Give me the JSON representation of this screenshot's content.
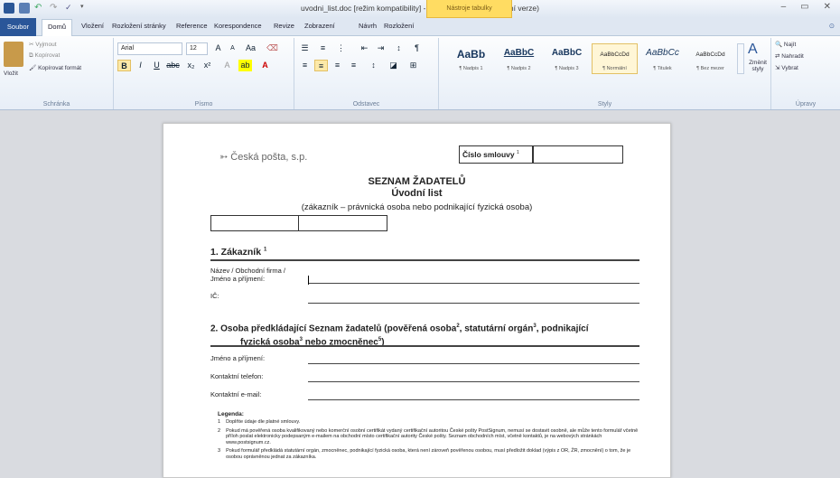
{
  "window": {
    "title": "uvodni_list.doc [režim kompatibility] - Microsoft Word (Zkušební verze)",
    "context_tab": "Nástroje tabulky",
    "controls": [
      "–",
      "▭",
      "✕"
    ]
  },
  "tabs": {
    "file": "Soubor",
    "items": [
      "Domů",
      "Vložení",
      "Rozložení stránky",
      "Reference",
      "Korespondence",
      "Revize",
      "Zobrazení",
      "Návrh",
      "Rozložení"
    ]
  },
  "ribbon": {
    "clipboard": {
      "paste": "Vložit",
      "cut": "Vyjmout",
      "copy": "Kopírovat",
      "format": "Kopírovat formát",
      "label": "Schránka"
    },
    "font": {
      "name": "Arial",
      "size": "12",
      "label": "Písmo"
    },
    "paragraph": {
      "label": "Odstavec"
    },
    "styles": {
      "label": "Styly",
      "change": "Změnit styly",
      "items": [
        {
          "sample": "AaBb",
          "name": "¶ Nadpis 1"
        },
        {
          "sample": "AaBbC",
          "name": "¶ Nadpis 2"
        },
        {
          "sample": "AaBbC",
          "name": "¶ Nadpis 3"
        },
        {
          "sample": "AaBbCcDd",
          "name": "¶ Normální"
        },
        {
          "sample": "AaBbCc",
          "name": "¶ Titulek"
        },
        {
          "sample": "AaBbCcDd",
          "name": "¶ Bez mezer"
        }
      ]
    },
    "editing": {
      "label": "Úpravy",
      "find": "Najít",
      "replace": "Nahradit",
      "select": "Vybrat"
    }
  },
  "document": {
    "logo_text": "Česká pošta, s.p.",
    "contract_label": "Číslo smlouvy",
    "contract_sup": "1",
    "heading1": "SEZNAM ŽADATELŮ",
    "heading2": "Úvodní list",
    "subheading": "(zákazník – právnická osoba nebo podnikající fyzická osoba)",
    "section1": "1. Zákazník",
    "section1_sup": "1",
    "field_name_l1": "Název / Obchodní firma /",
    "field_name_l2": "Jméno a příjmení:",
    "field_ic": "IČ:",
    "section2_l1": "2. Osoba předkládající Seznam žadatelů (pověřená osoba",
    "section2_l1_sup": "2",
    "section2_l1b": ", statutární orgán",
    "section2_l1b_sup": "3",
    "section2_l1c": ", podnikající",
    "section2_l2": "fyzická osoba",
    "section2_l2_sup": "3",
    "section2_l2b": " nebo zmocněnec",
    "section2_l2b_sup": "5",
    "section2_l2c": ")",
    "field_person": "Jméno a příjmení:",
    "field_phone": "Kontaktní telefon:",
    "field_email": "Kontaktní e-mail:",
    "legend_title": "Legenda:",
    "legend": [
      {
        "n": "1",
        "t": "Doplňte údaje dle platné smlouvy."
      },
      {
        "n": "2",
        "t": "Pokud má pověřená osoba kvalifikovaný nebo komerční osobní certifikát vydaný certifikační autoritou České pošty PostSignum, nemusí se dostavit osobně, ale může tento formulář včetně příloh poslat elektronicky podepsaným e-mailem na obchodní místo certifikační autority České pošty. Seznam obchodních míst, včetně kontaktů, je na webových stránkách www.postsignum.cz."
      },
      {
        "n": "3",
        "t": "Pokud formulář předkládá statutární orgán, zmocněnec, podnikající fyzická osoba, která není zároveň pověřenou osobou, musí předložit doklad (výpis z OR, ŽR, zmocnění) o tom, že je osobou oprávněnou jednat za zákazníka."
      }
    ]
  }
}
